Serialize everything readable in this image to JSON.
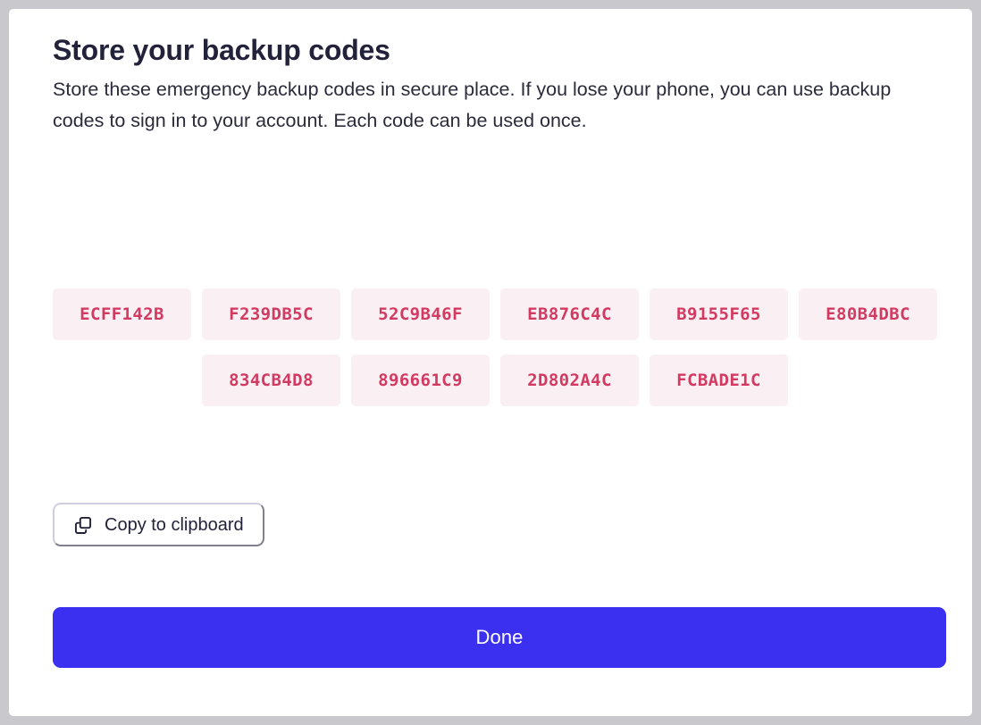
{
  "dialog": {
    "title": "Store your backup codes",
    "description": "Store these emergency backup codes in secure place. If you lose your phone, you can use backup codes to sign in to your account. Each code can be used once.",
    "backup_codes_row1": [
      "ECFF142B",
      "F239DB5C",
      "52C9B46F",
      "EB876C4C",
      "B9155F65",
      "E80B4DBC"
    ],
    "backup_codes_row2": [
      "834CB4D8",
      "896661C9",
      "2D802A4C",
      "FCBADE1C"
    ],
    "copy_button": {
      "label": "Copy to clipboard",
      "icon": "copy-icon"
    },
    "done_button": {
      "label": "Done"
    },
    "colors": {
      "page_background": "#c9c9cd",
      "card_background": "#ffffff",
      "title_text": "#22223b",
      "code_chip_background": "#faf0f3",
      "code_chip_text": "#d33a62",
      "copy_button_border": "#cfcede",
      "done_button_background": "#3b30f0",
      "done_button_text": "#ffffff"
    }
  }
}
